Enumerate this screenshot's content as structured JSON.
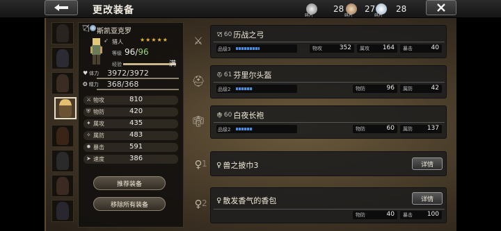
{
  "header": {
    "title": "更改装备"
  },
  "resources": [
    {
      "label": "碎片",
      "value": "28",
      "color": "#bcbcbc"
    },
    {
      "label": "碎片",
      "value": "27",
      "color": "#d8b090"
    },
    {
      "label": "碎片",
      "value": "28",
      "color": "#dddddd"
    }
  ],
  "character": {
    "name": "斯凯亚克罗",
    "job": "猎人",
    "stars": "★★★★★",
    "level_label": "等级",
    "level": "96",
    "level_max": "96",
    "exp_label": "经验",
    "exp_state": "满",
    "exp_fraction": 1.0,
    "hp_label": "体力",
    "hp": "3972",
    "hp_max": "3972",
    "sp_label": "精力",
    "sp": "368",
    "sp_max": "368",
    "stats": [
      {
        "label": "物攻",
        "value": "810"
      },
      {
        "label": "物防",
        "value": "420"
      },
      {
        "label": "属攻",
        "value": "435"
      },
      {
        "label": "属防",
        "value": "483"
      },
      {
        "label": "暴击",
        "value": "591"
      },
      {
        "label": "速度",
        "value": "386"
      }
    ]
  },
  "buttons": {
    "recommend": "推荐装备",
    "remove_all": "移除所有装备"
  },
  "equipment": [
    {
      "icon": "sword-icon",
      "prefix": "60",
      "name": "历战之弓",
      "rank": "品级3",
      "rank_level": 0.6,
      "stats": [
        {
          "k": "物攻",
          "v": "352"
        },
        {
          "k": "属攻",
          "v": "164"
        },
        {
          "k": "暴击",
          "v": "40"
        }
      ]
    },
    {
      "icon": "helmet-icon",
      "prefix": "61",
      "name": "芬里尔头盔",
      "rank": "品级2",
      "rank_level": 0.4,
      "stats": [
        {
          "k": "物防",
          "v": "96"
        },
        {
          "k": "属防",
          "v": "42"
        }
      ]
    },
    {
      "icon": "armor-icon",
      "prefix": "60",
      "name": "白夜长袍",
      "rank": "品级2",
      "rank_level": 0.4,
      "stats": [
        {
          "k": "物防",
          "v": "60"
        },
        {
          "k": "属防",
          "v": "137"
        }
      ]
    },
    {
      "icon": "accessory-icon",
      "slot": "1",
      "name": "兽之披巾3",
      "detail": "详情",
      "stats": []
    },
    {
      "icon": "accessory-icon",
      "slot": "2",
      "name": "散发香气的香包",
      "detail": "详情",
      "stats": [
        {
          "k": "物防",
          "v": "40"
        },
        {
          "k": "暴击",
          "v": "100"
        }
      ]
    }
  ],
  "colors": {
    "accent_blue": "#4f8cd8",
    "star": "#e8b83c",
    "max_green": "#9cd27a"
  }
}
